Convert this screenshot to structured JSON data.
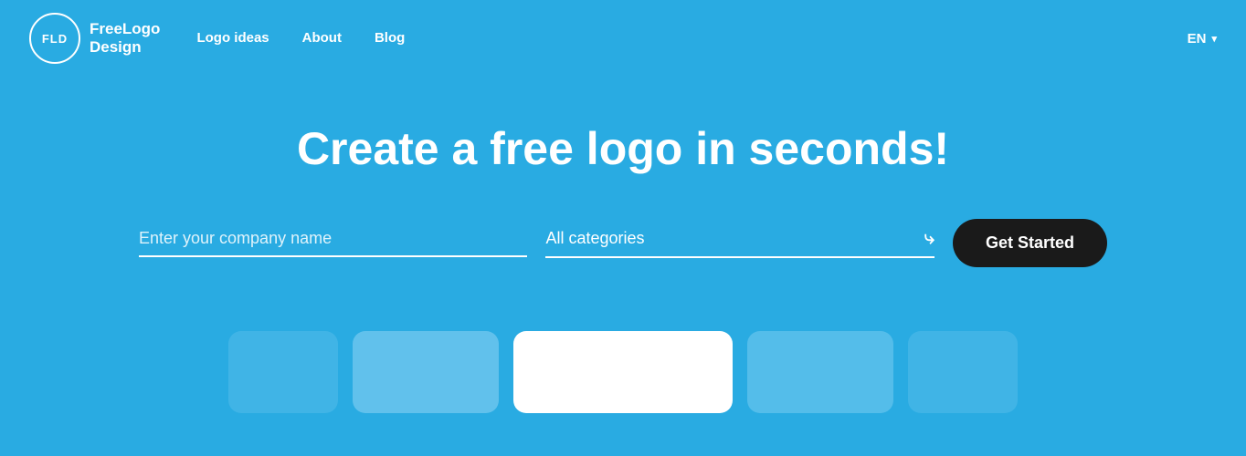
{
  "nav": {
    "logo_initials": "FLD",
    "logo_name_line1": "FreeLogo",
    "logo_name_line2": "Design",
    "links": [
      {
        "label": "Logo ideas",
        "id": "logo-ideas"
      },
      {
        "label": "About",
        "id": "about"
      },
      {
        "label": "Blog",
        "id": "blog"
      }
    ],
    "language": "EN",
    "language_chevron": "▾"
  },
  "hero": {
    "title": "Create a free logo in seconds!",
    "company_input_placeholder": "Enter your company name",
    "category_label": "All categories",
    "category_chevron": "⌄",
    "cta_button": "Get Started"
  },
  "colors": {
    "background": "#29abe2",
    "cta_bg": "#1a1a1a"
  }
}
